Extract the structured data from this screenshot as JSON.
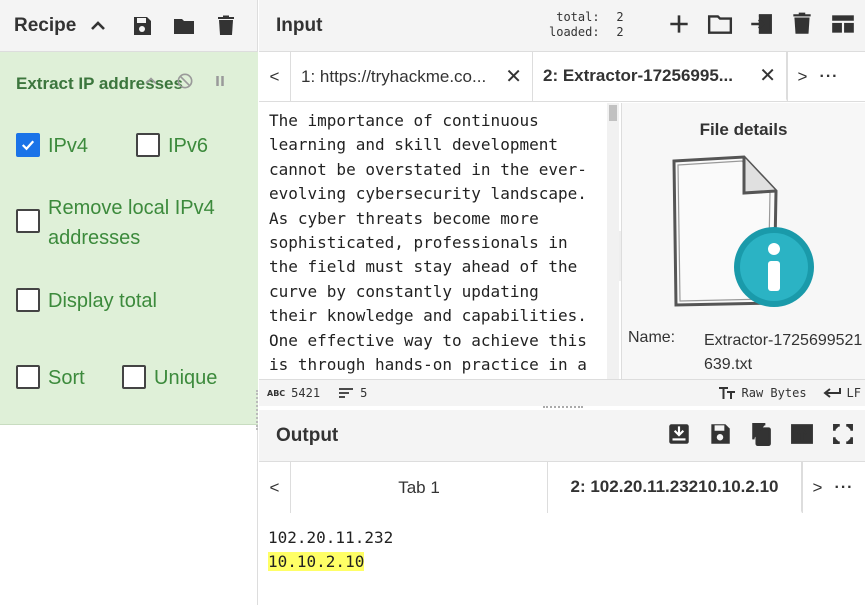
{
  "recipe": {
    "title": "Recipe",
    "operation": {
      "name": "Extract IP addresses",
      "options": {
        "ipv4": {
          "label": "IPv4",
          "checked": true
        },
        "ipv6": {
          "label": "IPv6",
          "checked": false
        },
        "remove_local_line1": "Remove local IPv4",
        "remove_local_line2": "addresses",
        "display_total": "Display total",
        "sort": "Sort",
        "unique": "Unique"
      }
    }
  },
  "input": {
    "title": "Input",
    "counts": {
      "total_label": "total:",
      "total": "2",
      "loaded_label": "loaded:",
      "loaded": "2"
    },
    "tabs": [
      {
        "label": "1: https://tryhackme.co..."
      },
      {
        "label": "2: Extractor-17256995..."
      }
    ],
    "text": "The importance of continuous\nlearning and skill development\ncannot be overstated in the ever-\nevolving cybersecurity landscape.\nAs cyber threats become more\nsophisticated, professionals in\nthe field must stay ahead of the\ncurve by constantly updating\ntheir knowledge and capabilities.\nOne effective way to achieve this\nis through hands-on practice in a",
    "file_details": {
      "title": "File details",
      "name_label": "Name:",
      "name_value": "Extractor-1725699521639.txt"
    },
    "status": {
      "chars_icon": "ABC",
      "chars": "5421",
      "lines": "5",
      "format": "Raw Bytes",
      "eol": "LF"
    }
  },
  "output": {
    "title": "Output",
    "tabs": [
      {
        "label": "Tab 1"
      },
      {
        "label": "2: 102.20.11.23210.10.2.10"
      }
    ],
    "lines": [
      "102.20.11.232",
      "10.10.2.10"
    ]
  },
  "colors": {
    "recipe_bg": "#dff0d8",
    "op_text": "#3c763d",
    "checkbox_checked": "#1a73e8",
    "highlight": "#ffff66"
  }
}
